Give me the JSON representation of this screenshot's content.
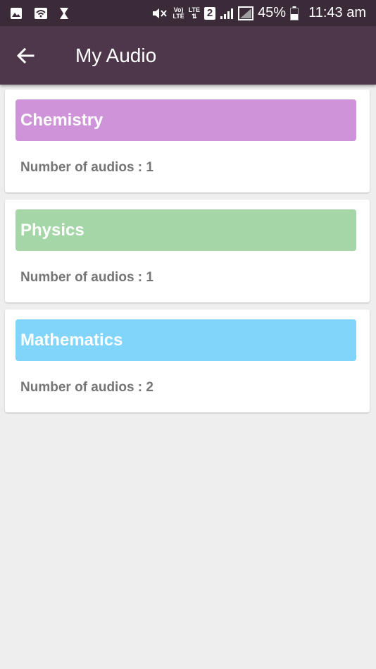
{
  "status_bar": {
    "battery_percent": "45%",
    "time": "11:43 am",
    "volte_top": "Vo)",
    "volte_bottom": "LTE",
    "lte_top": "LTE",
    "lte_bottom": "⇅",
    "sim_number": "2",
    "icons": [
      "gallery-icon",
      "wifi-icon",
      "hourglass-icon",
      "mute-icon",
      "volte-icon",
      "lte-icon",
      "sim-icon",
      "signal-icon",
      "signal-empty-icon",
      "battery-icon"
    ]
  },
  "app_bar": {
    "title": "My Audio",
    "back_icon": "arrow-left-icon"
  },
  "subjects": [
    {
      "name": "Chemistry",
      "count_text": "Number of audios : 1",
      "color": "#ce93d8"
    },
    {
      "name": "Physics",
      "count_text": "Number of audios : 1",
      "color": "#a5d6a7"
    },
    {
      "name": "Mathematics",
      "count_text": "Number of audios : 2",
      "color": "#81d4fa"
    }
  ]
}
